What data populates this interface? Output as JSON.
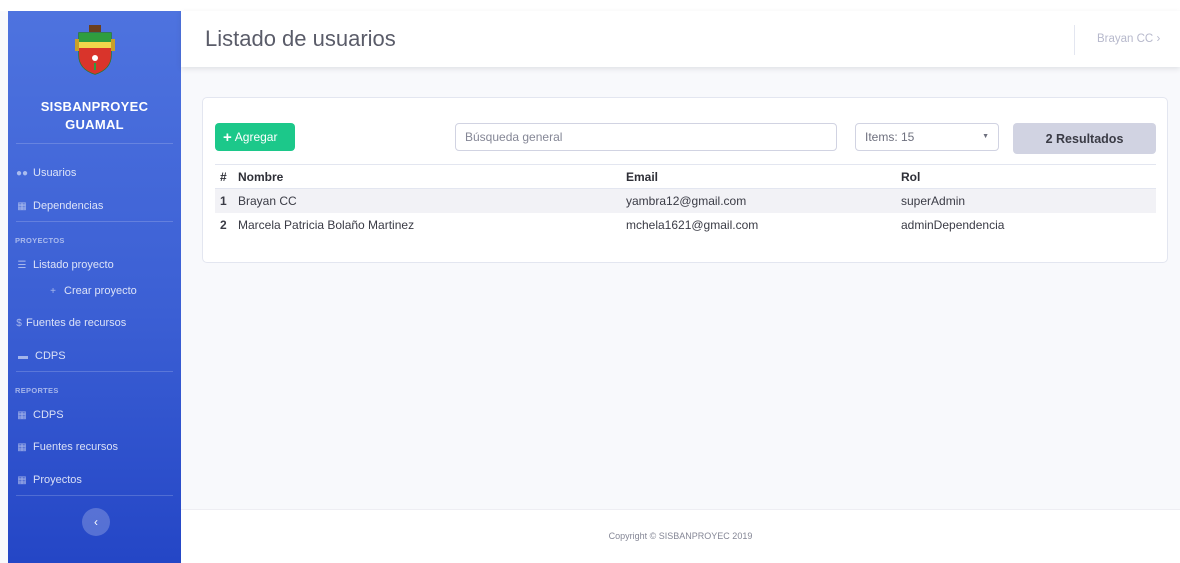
{
  "sidebar": {
    "brand_line1": "SISBANPROYEC",
    "brand_line2": "GUAMAL",
    "items": [
      {
        "label": "Usuarios",
        "icon": "users-icon"
      },
      {
        "label": "Dependencias",
        "icon": "sitemap-icon"
      }
    ],
    "section_projects": "PROYECTOS",
    "projects_items": [
      {
        "label": "Listado proyecto",
        "icon": "list-icon"
      },
      {
        "label": "Crear proyecto",
        "icon": "plus-icon"
      },
      {
        "label": "Fuentes de recursos",
        "icon": "dollar-icon"
      },
      {
        "label": "CDPS",
        "icon": "card-icon"
      }
    ],
    "section_reports": "REPORTES",
    "reports_items": [
      {
        "label": "CDPS",
        "icon": "table-icon"
      },
      {
        "label": "Fuentes recursos",
        "icon": "table-icon"
      },
      {
        "label": "Proyectos",
        "icon": "table-icon"
      }
    ],
    "toggle_label": "‹"
  },
  "header": {
    "title": "Listado de usuarios",
    "user": "Brayan CC",
    "user_chevron": "›"
  },
  "toolbar": {
    "add_label": "Agregar",
    "search_placeholder": "Búsqueda general",
    "items_select": "Items: 15",
    "results": "2 Resultados"
  },
  "table": {
    "headers": [
      "#",
      "Nombre",
      "Email",
      "Rol"
    ],
    "rows": [
      {
        "num": "1",
        "name": "Brayan CC",
        "email": "yambra12@gmail.com",
        "role": "superAdmin"
      },
      {
        "num": "2",
        "name": "Marcela Patricia Bolaño Martinez",
        "email": "mchela1621@gmail.com",
        "role": "adminDependencia"
      }
    ]
  },
  "footer": {
    "copyright": "Copyright © SISBANPROYEC 2019"
  },
  "colors": {
    "sidebar_top": "#4e73df",
    "sidebar_bottom": "#2446c6",
    "success": "#1cc88a",
    "badge": "#d1d3e2"
  }
}
